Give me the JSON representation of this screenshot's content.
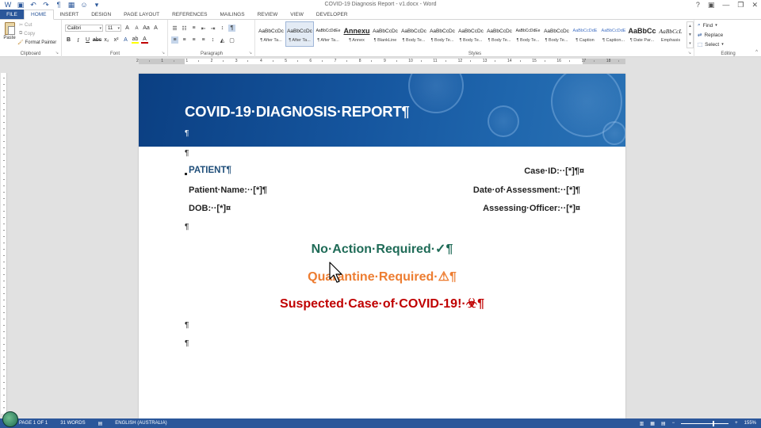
{
  "window": {
    "title": "COVID-19 Diagnosis Report - v1.docx - Word",
    "controls": [
      "?",
      "▣",
      "—",
      "❐",
      "✕"
    ]
  },
  "tabs": [
    "FILE",
    "HOME",
    "INSERT",
    "DESIGN",
    "PAGE LAYOUT",
    "REFERENCES",
    "MAILINGS",
    "REVIEW",
    "VIEW",
    "DEVELOPER"
  ],
  "active_tab": "HOME",
  "ribbon": {
    "clipboard": {
      "label": "Clipboard",
      "paste": "Paste",
      "cut": "Cut",
      "copy": "Copy",
      "format_painter": "Format Painter"
    },
    "font": {
      "label": "Font",
      "family": "Calibri",
      "size": "11"
    },
    "paragraph": {
      "label": "Paragraph"
    },
    "styles": {
      "label": "Styles",
      "items": [
        {
          "preview": "AaBbCcDc",
          "name": "¶ After Ta..."
        },
        {
          "preview": "AaBbCcDc",
          "name": "¶ After Ta..."
        },
        {
          "preview": "AaBbCcDdEe",
          "name": "¶ After Ta..."
        },
        {
          "preview": "Annexu",
          "name": "¶ Annex"
        },
        {
          "preview": "AaBbCcDc",
          "name": "¶ BlankLine"
        },
        {
          "preview": "AaBbCcDc",
          "name": "¶ Body Te..."
        },
        {
          "preview": "AaBbCcDc",
          "name": "¶ Body Te..."
        },
        {
          "preview": "AaBbCcDc",
          "name": "¶ Body Te..."
        },
        {
          "preview": "AaBbCcDc",
          "name": "¶ Body Te..."
        },
        {
          "preview": "AaBbCcDdEe",
          "name": "¶ Body Te..."
        },
        {
          "preview": "AaBbCcDc",
          "name": "¶ Body Te..."
        },
        {
          "preview": "AaBbCcDdE",
          "name": "¶ Caption"
        },
        {
          "preview": "AaBbCcDdE",
          "name": "¶ Caption..."
        },
        {
          "preview": "AaBbCc",
          "name": "¶ Date Par..."
        },
        {
          "preview": "AaBbCcL",
          "name": "Emphasis"
        }
      ]
    },
    "editing": {
      "label": "Editing",
      "find": "Find",
      "replace": "Replace",
      "select": "Select"
    }
  },
  "ruler": {
    "numbers": [
      "2",
      "1",
      "1",
      "2",
      "3",
      "4",
      "5",
      "6",
      "7",
      "8",
      "9",
      "10",
      "11",
      "12",
      "13",
      "14",
      "15",
      "16",
      "17",
      "18"
    ]
  },
  "document": {
    "title": "COVID-19·DIAGNOSIS·REPORT¶",
    "pilcrow": "¶",
    "patient_heading": "PATIENT¶",
    "case_id": "Case·ID:··[*]¶¤",
    "patient_name": "Patient·Name:··[*]¶",
    "date_of_assessment": "Date·of·Assessment:··[*]¶",
    "dob": "DOB:··[*]¤",
    "assessing_officer": "Assessing·Officer:··[*]¤",
    "status_ok": "No·Action·Required·✓¶",
    "status_warn": "Quarantine·Required·⚠¶",
    "status_alert": "Suspected·Case·of·COVID-19!·☣¶"
  },
  "statusbar": {
    "page": "PAGE 1 OF 1",
    "words": "31 WORDS",
    "language": "ENGLISH (AUSTRALIA)",
    "zoom": "155%"
  },
  "colors": {
    "accent": "#2b579a",
    "banner": "#15559e",
    "patient_heading": "#1f4e79",
    "ok": "#1f6b57",
    "warn": "#ed7d31",
    "alert": "#c00000"
  }
}
